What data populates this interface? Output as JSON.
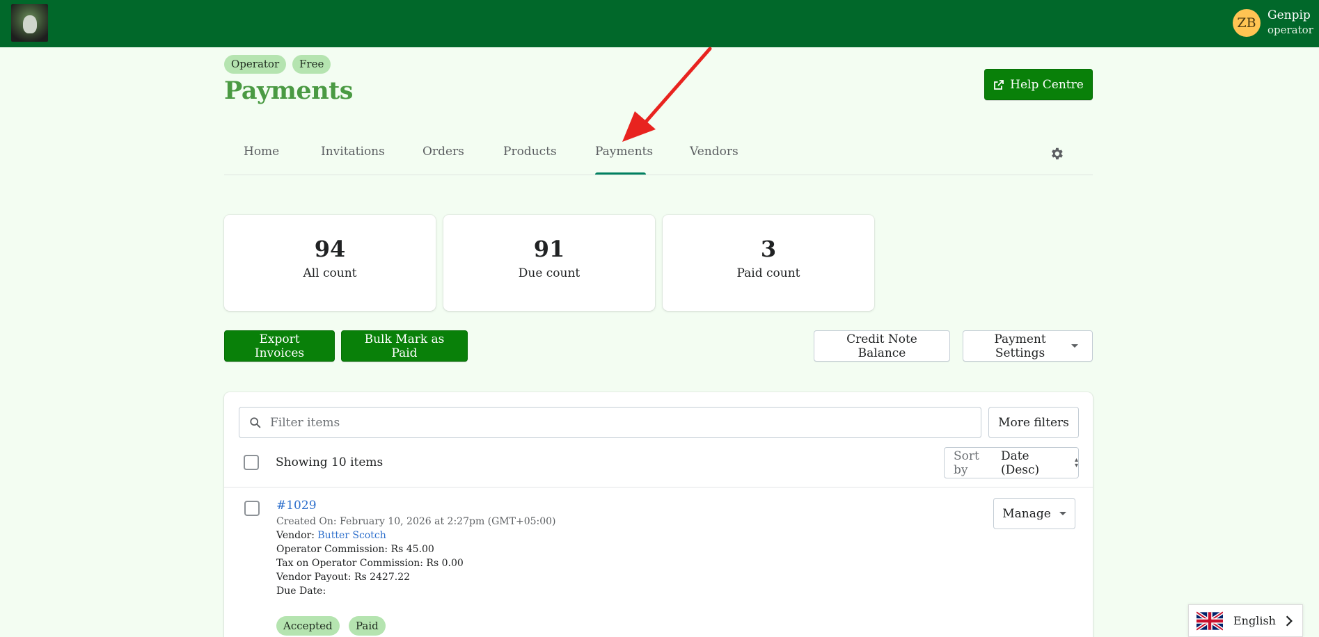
{
  "user": {
    "initials": "ZB",
    "name": "Genpip",
    "role": "operator"
  },
  "header": {
    "badges": [
      "Operator",
      "Free"
    ],
    "title": "Payments",
    "help_button": "Help Centre"
  },
  "tabs": [
    {
      "label": "Home",
      "active": false
    },
    {
      "label": "Invitations",
      "active": false
    },
    {
      "label": "Orders",
      "active": false
    },
    {
      "label": "Products",
      "active": false
    },
    {
      "label": "Payments",
      "active": true
    },
    {
      "label": "Vendors",
      "active": false
    }
  ],
  "stats": [
    {
      "value": "94",
      "label": "All count"
    },
    {
      "value": "91",
      "label": "Due count"
    },
    {
      "value": "3",
      "label": "Paid count"
    }
  ],
  "actions": {
    "export_invoices": "Export Invoices",
    "bulk_mark_paid": "Bulk Mark as Paid",
    "credit_note_balance": "Credit Note Balance",
    "payment_settings": "Payment Settings"
  },
  "list": {
    "search_placeholder": "Filter items",
    "more_filters": "More filters",
    "showing": "Showing 10 items",
    "sort_label": "Sort by",
    "sort_value": "Date (Desc)",
    "items": [
      {
        "id": "#1029",
        "created_on": "Created On: February 10, 2026 at 2:27pm (GMT+05:00)",
        "vendor_label": "Vendor: ",
        "vendor_name": "Butter Scotch",
        "operator_commission": "Operator Commission: Rs 45.00",
        "tax_on_commission": "Tax on Operator Commission: Rs 0.00",
        "vendor_payout": "Vendor Payout: Rs 2427.22",
        "due_date": "Due Date:",
        "manage_label": "Manage",
        "status_badges": [
          "Accepted",
          "Paid"
        ]
      }
    ]
  },
  "language": {
    "label": "English",
    "flag_icon": "uk-flag-icon"
  },
  "colors": {
    "topbar": "#01682a",
    "primary_button": "#098009",
    "title": "#4a9a43",
    "badge": "#b5e4b0",
    "tab_active": "#008060",
    "link": "#2c6ecb",
    "annotation_arrow": "#e8231f"
  }
}
